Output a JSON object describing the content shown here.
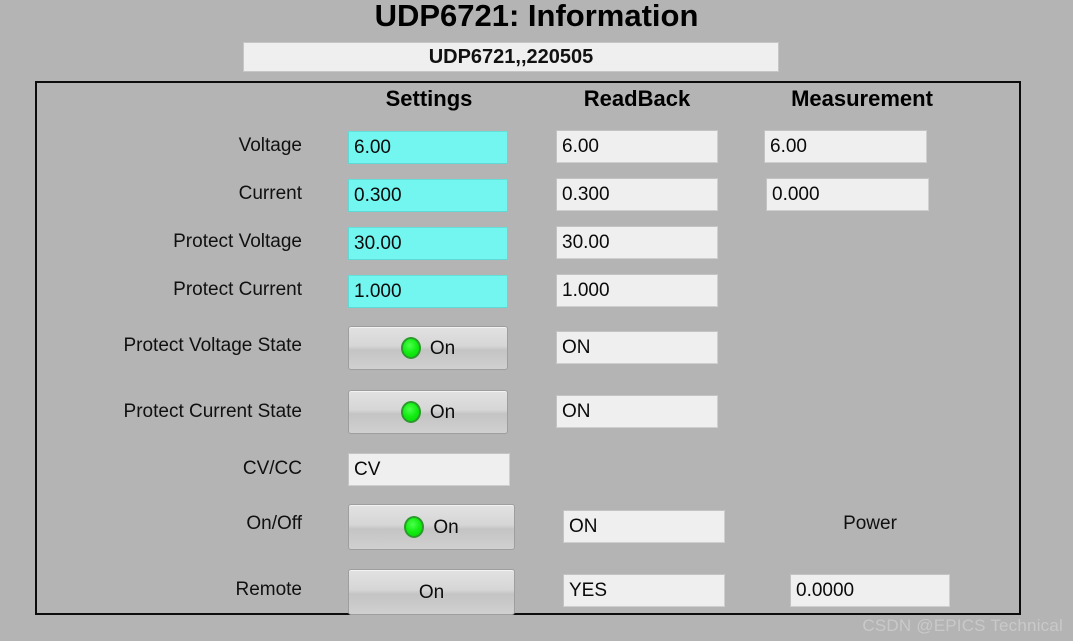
{
  "window": {
    "title": "UDP6721: Information",
    "device_id": "UDP6721,,220505"
  },
  "columns": {
    "settings": "Settings",
    "readback": "ReadBack",
    "measurement": "Measurement"
  },
  "rows": [
    {
      "label": "Voltage",
      "setting": "6.00",
      "readback": "6.00",
      "measurement": "6.00"
    },
    {
      "label": "Current",
      "setting": "0.300",
      "readback": "0.300",
      "measurement": "0.000"
    },
    {
      "label": "Protect Voltage",
      "setting": "30.00",
      "readback": "30.00"
    },
    {
      "label": "Protect Current",
      "setting": "1.000",
      "readback": "1.000"
    },
    {
      "label": "Protect Voltage State",
      "button": "On",
      "readback": "ON"
    },
    {
      "label": "Protect Current State",
      "button": "On",
      "readback": "ON"
    },
    {
      "label": "CV/CC",
      "setting_readout": "CV"
    },
    {
      "label": "On/Off",
      "button": "On",
      "readback": "ON",
      "measurement_label": "Power"
    },
    {
      "label": "Remote",
      "button": "On",
      "readback": "YES",
      "measurement": "0.0000"
    }
  ],
  "watermark": "CSDN @EPICS Technical",
  "colors": {
    "background": "#b4b4b4",
    "setting_field": "#73f5f0",
    "readout_field": "#efefef",
    "led_on": "#13ee13",
    "panel_border": "#0d0d0d"
  }
}
